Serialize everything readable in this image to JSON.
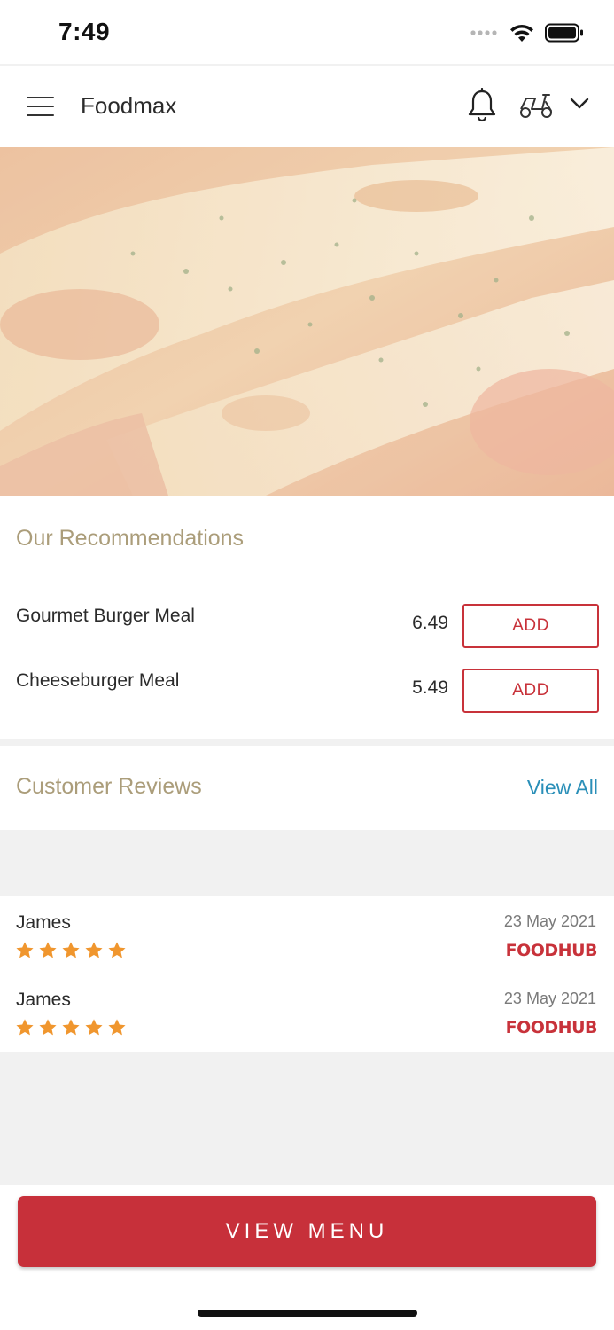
{
  "status_bar": {
    "time": "7:49"
  },
  "app_bar": {
    "title": "Foodmax"
  },
  "recommendations": {
    "title": "Our Recommendations",
    "items": [
      {
        "name": "Gourmet Burger Meal",
        "price": "6.49",
        "button_label": "ADD"
      },
      {
        "name": "Cheeseburger Meal",
        "price": "5.49",
        "button_label": "ADD"
      }
    ]
  },
  "reviews": {
    "title": "Customer Reviews",
    "view_all_label": "View All",
    "items": [
      {
        "name": "James",
        "rating": 5,
        "date": "23 May 2021",
        "source": "FOODHUB"
      },
      {
        "name": "James",
        "rating": 5,
        "date": "23 May 2021",
        "source": "FOODHUB"
      }
    ]
  },
  "footer": {
    "button_label": "VIEW MENU"
  },
  "colors": {
    "accent": "#c8323a",
    "section_title": "#ab9d7a",
    "link": "#2a8fb8",
    "star": "#f0962e"
  }
}
